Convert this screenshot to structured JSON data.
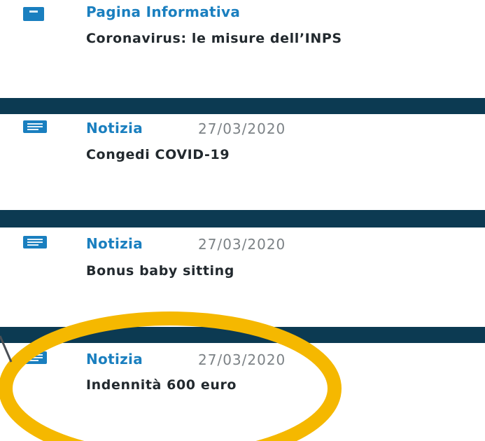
{
  "items": [
    {
      "type_label": "Pagina Informativa",
      "date": "",
      "title": "Coronavirus: le misure dell’INPS",
      "icon": "document-icon"
    },
    {
      "type_label": "Notizia",
      "date": "27/03/2020",
      "title": "Congedi COVID-19",
      "icon": "news-icon"
    },
    {
      "type_label": "Notizia",
      "date": "27/03/2020",
      "title": "Bonus baby sitting",
      "icon": "news-icon"
    },
    {
      "type_label": "Notizia",
      "date": "27/03/2020",
      "title": "Indennità 600 euro",
      "icon": "news-icon"
    }
  ],
  "colors": {
    "band": "#0c3a52",
    "accent": "#1a7fbf",
    "date": "#7c8286",
    "title": "#22292e",
    "highlight": "#f5b800"
  }
}
